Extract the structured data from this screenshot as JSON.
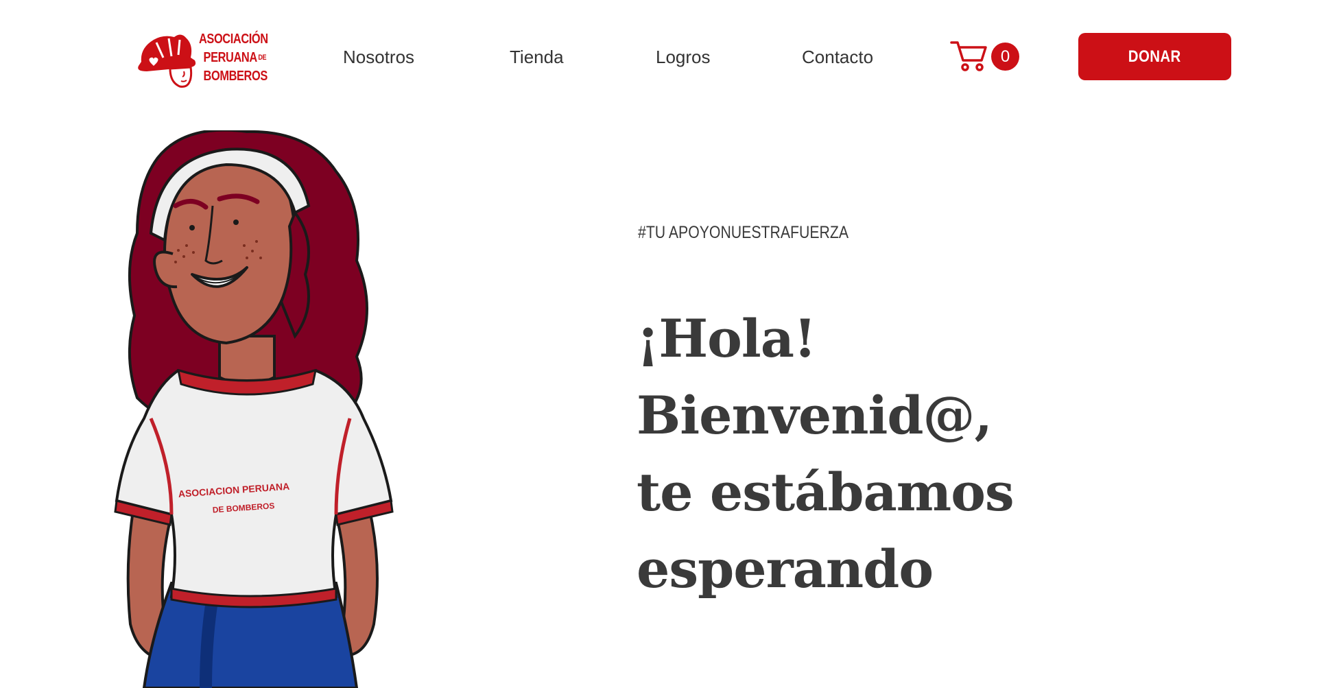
{
  "brand": {
    "name_line1": "ASOCIACIÓN",
    "name_line2": "PERUANA",
    "name_line2_small": "DE",
    "name_line3": "BOMBEROS",
    "logo_icon": "firefighter-helmet-head-with-heart",
    "color": "#cc1016"
  },
  "nav": {
    "items": [
      {
        "label": "Nosotros"
      },
      {
        "label": "Tienda"
      },
      {
        "label": "Logros"
      },
      {
        "label": "Contacto"
      }
    ],
    "cart": {
      "icon": "cart-icon",
      "count": "0"
    },
    "donate_label": "DONAR"
  },
  "hero": {
    "hashtag": "#TU APOYONUESTRAFUERZA",
    "title_lines": [
      "¡Hola!",
      "Bienvenid@,",
      "te estábamos",
      "esperando"
    ],
    "shirt_text_line1": "ASOCIACION PERUANA",
    "shirt_text_line2": "DE BOMBEROS",
    "illustration": "smiling-girl-in-association-tshirt"
  },
  "colors": {
    "accent": "#cc1016",
    "text": "#3a3a3a",
    "hair": "#7d0022",
    "skin": "#b86552",
    "shirt": "#efefef",
    "skirt": "#1a44a0"
  }
}
